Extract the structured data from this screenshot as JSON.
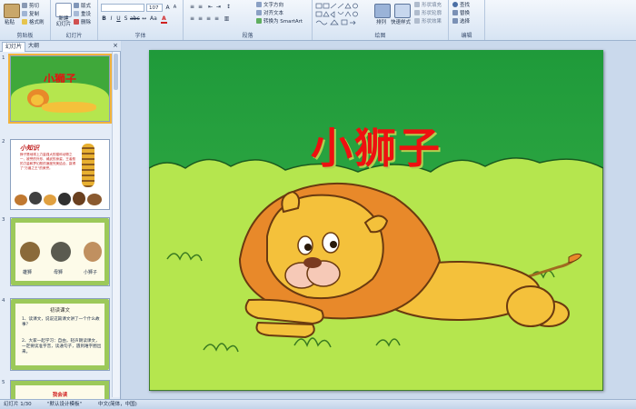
{
  "ribbon": {
    "clipboard": {
      "group_label": "剪贴板",
      "paste": "粘贴",
      "cut": "剪切",
      "copy": "复制",
      "format_painter": "格式刷"
    },
    "slides": {
      "group_label": "幻灯片",
      "new_slide": "新建\n幻灯片",
      "layout": "版式",
      "reset": "重设",
      "delete": "删除"
    },
    "font": {
      "group_label": "字体",
      "font_name": "",
      "font_size": "107"
    },
    "paragraph": {
      "group_label": "段落",
      "text_direction": "文字方向",
      "align_text": "对齐文本",
      "smartart": "转换为 SmartArt"
    },
    "drawing": {
      "group_label": "绘图",
      "arrange": "排列",
      "quick_styles": "快速样式",
      "shape_fill": "形状填充",
      "shape_outline": "形状轮廓",
      "shape_effects": "形状效果"
    },
    "editing": {
      "group_label": "编辑",
      "find": "查找",
      "replace": "替换",
      "select": "选择"
    }
  },
  "pane": {
    "tabs": [
      "幻灯片",
      "大纲"
    ],
    "slides": [
      {
        "number": "1",
        "title": "小狮子"
      },
      {
        "number": "2",
        "title": "小知识",
        "body": "狮子是地球上力量强大的猫科动物之一，被誉的外形、威武的身姿、王者般的力量和梦幻般的速度完美结合，赢得了\"万兽之王\"的美誉。"
      },
      {
        "number": "3",
        "captions": [
          "雄狮",
          "母狮",
          "小狮子"
        ]
      },
      {
        "number": "4",
        "title": "初读课文",
        "items": [
          "1、读课文，说说这篇课文讲了一个什么故事？",
          "2、大家一起学习：自由，轻声朗读课文，一定要读准字音，读通句子，遇到难字圈出来。"
        ]
      },
      {
        "number": "5",
        "title": "我会读"
      }
    ]
  },
  "slide": {
    "title": "小狮子"
  },
  "status": {
    "slide_indicator": "幻灯片 1/30",
    "theme": "\"默认设计模板\"",
    "language": "中文(简体，中国)"
  },
  "colors": {
    "slide_bg": "#1f9a3a",
    "grass": "#b5e64e",
    "title_red": "#ee1010",
    "lion_body": "#f4c13b",
    "mane": "#e8892a"
  }
}
